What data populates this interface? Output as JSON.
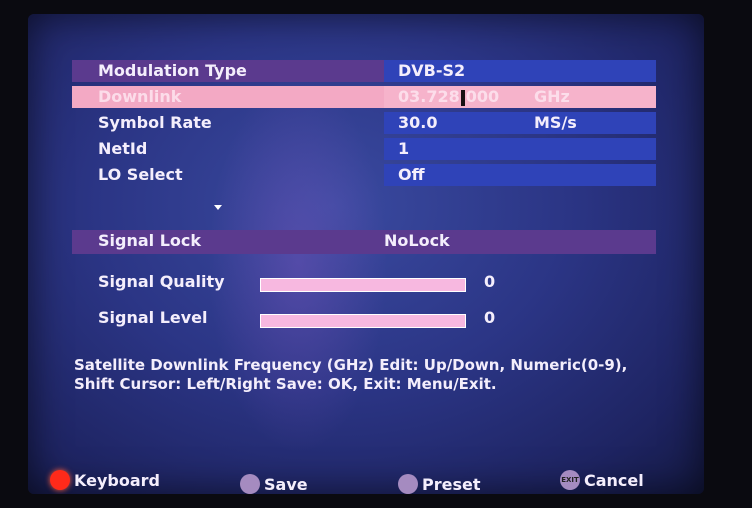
{
  "settings": {
    "modulation": {
      "label": "Modulation Type",
      "value": "DVB-S2"
    },
    "downlink": {
      "label": "Downlink",
      "value_before": "03.728",
      "value_after": "000",
      "unit": "GHz"
    },
    "symbol_rate": {
      "label": "Symbol Rate",
      "value": "30.0",
      "unit": "MS/s"
    },
    "netid": {
      "label": "NetId",
      "value": "1"
    },
    "lo_select": {
      "label": "LO Select",
      "value": "Off"
    }
  },
  "signal": {
    "lock": {
      "label": "Signal Lock",
      "value": "NoLock"
    },
    "quality": {
      "label": "Signal Quality",
      "value": "0",
      "level": 0
    },
    "level": {
      "label": "Signal Level",
      "value": "0",
      "level": 0
    }
  },
  "help_text": "Satellite Downlink Frequency (GHz) Edit: Up/Down, Numeric(0-9), Shift Cursor: Left/Right Save: OK, Exit: Menu/Exit.",
  "footer": {
    "keyboard": "Keyboard",
    "save": "Save",
    "preset": "Preset",
    "cancel": "Cancel",
    "cancel_badge": "EXIT"
  },
  "colors": {
    "background": "#2b3585",
    "value_box": "#2f43b8",
    "row_highlight": "#5b3a8e",
    "selected_row": "#f3a9c4",
    "signal_bar": "#f7b8e0",
    "keyboard_dot": "#ff2a1a"
  }
}
